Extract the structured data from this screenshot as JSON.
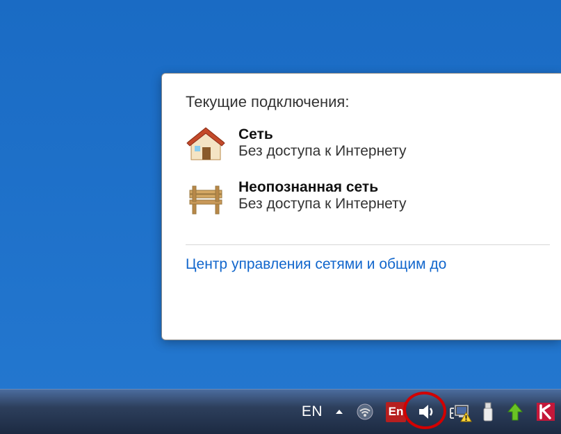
{
  "popup": {
    "title": "Текущие подключения:",
    "networks": [
      {
        "name": "Сеть",
        "status": "Без доступа к Интернету",
        "icon": "house"
      },
      {
        "name": "Неопознанная сеть",
        "status": "Без доступа к Интернету",
        "icon": "bench"
      }
    ],
    "link": "Центр управления сетями и общим до"
  },
  "tray": {
    "lang_short": "EN",
    "en_badge": "En"
  }
}
